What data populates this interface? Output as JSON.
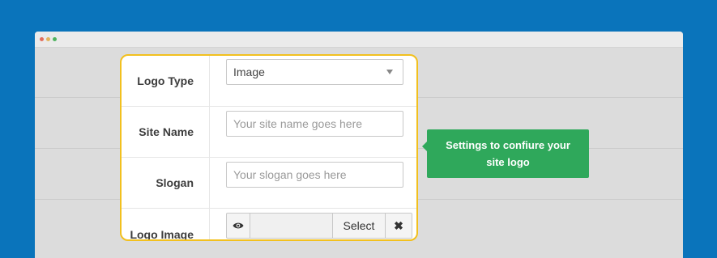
{
  "colors": {
    "background": "#0a74bb",
    "panel_border": "#f2c01e",
    "tooltip": "#2fa85b"
  },
  "form": {
    "logo_type": {
      "label": "Logo Type",
      "value": "Image"
    },
    "site_name": {
      "label": "Site Name",
      "placeholder": "Your site name goes here"
    },
    "slogan": {
      "label": "Slogan",
      "placeholder": "Your slogan goes here"
    },
    "logo_image": {
      "label": "Logo Image",
      "select_label": "Select",
      "remove_symbol": "✖",
      "preview_icon": "eye-icon"
    }
  },
  "tooltip": {
    "text": "Settings to confiure your site logo"
  }
}
